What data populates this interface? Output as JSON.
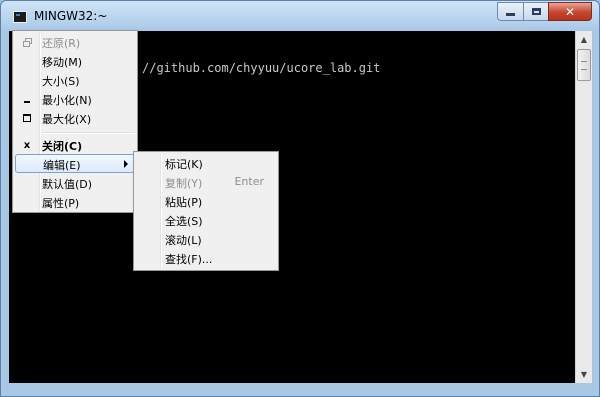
{
  "window": {
    "title": "MINGW32:~"
  },
  "console": {
    "text": "//github.com/chyyuu/ucore_lab.git"
  },
  "system_menu": {
    "items": [
      {
        "label": "还原(R)",
        "icon": "restore-icon",
        "disabled": true
      },
      {
        "label": "移动(M)"
      },
      {
        "label": "大小(S)"
      },
      {
        "label": "最小化(N)",
        "icon": "minimize-icon"
      },
      {
        "label": "最大化(X)",
        "icon": "maximize-icon"
      },
      {
        "label": "关闭(C)",
        "icon": "close-icon",
        "bold": true
      },
      {
        "label": "编辑(E)",
        "highlighted": true,
        "submenu": true
      },
      {
        "label": "默认值(D)"
      },
      {
        "label": "属性(P)"
      }
    ]
  },
  "edit_menu": {
    "items": [
      {
        "label": "标记(K)"
      },
      {
        "label": "复制(Y)",
        "shortcut": "Enter",
        "disabled": true
      },
      {
        "label": "粘贴(P)"
      },
      {
        "label": "全选(S)"
      },
      {
        "label": "滚动(L)"
      },
      {
        "label": "查找(F)..."
      }
    ]
  },
  "colors": {
    "console_bg": "#000000",
    "menu_bg": "#f0f0f0",
    "highlight_border": "#7da2ce"
  }
}
